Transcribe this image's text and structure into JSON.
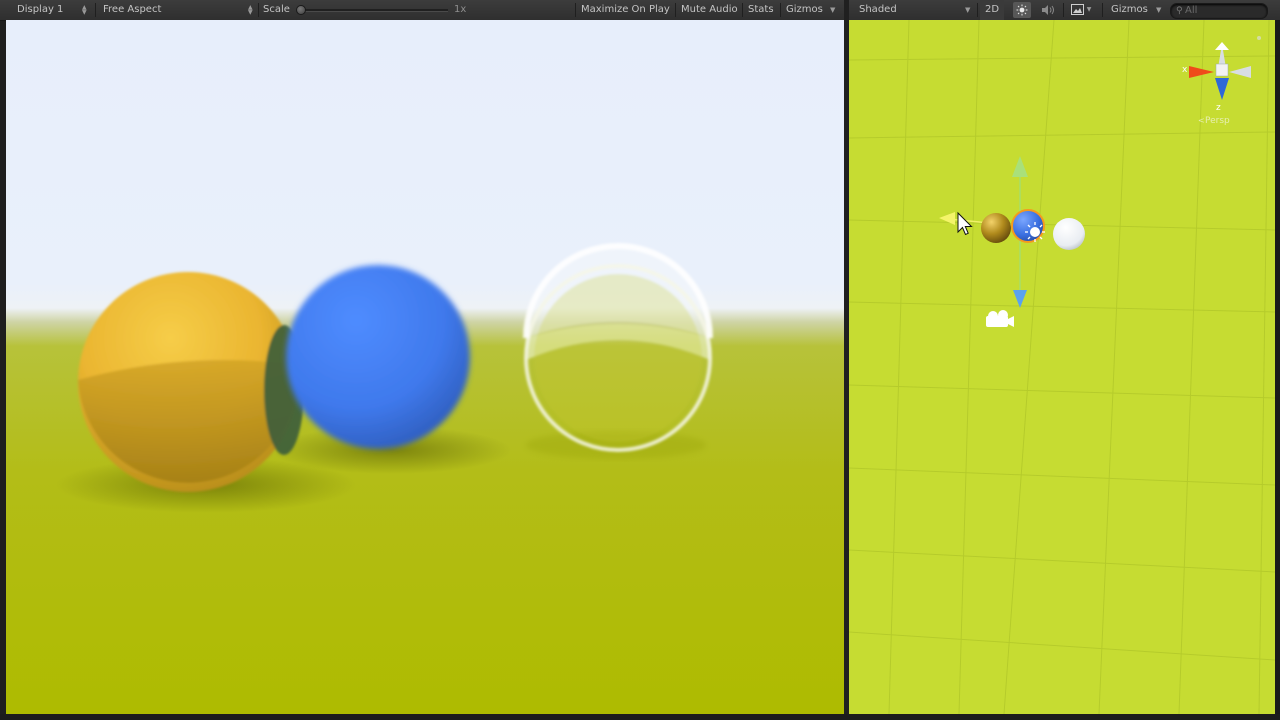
{
  "game_toolbar": {
    "display_select": "Display 1",
    "aspect_select": "Free Aspect",
    "scale_label": "Scale",
    "scale_value": "1x",
    "scale_fraction": 0,
    "maximize_on_play": "Maximize On Play",
    "mute_audio": "Mute Audio",
    "stats": "Stats",
    "gizmos": "Gizmos"
  },
  "scene_toolbar": {
    "draw_mode_select": "Shaded",
    "mode_2d": "2D",
    "lighting_icon": "sun-icon",
    "audio_icon": "speaker-icon",
    "effects_icon": "image-icon",
    "gizmos": "Gizmos",
    "search_placeholder": "All",
    "search_icon": "magnifier-icon"
  },
  "scene_view": {
    "orientation_gizmo": {
      "x_label": "x",
      "z_label": "z",
      "projection_label": "Persp"
    },
    "objects": [
      "gold-sphere",
      "blue-sphere",
      "white-sphere",
      "directional-light",
      "camera"
    ],
    "cursor_icon": "arrow-cursor-icon"
  },
  "game_view": {
    "objects": [
      "yellow-sphere",
      "blue-sphere",
      "glass-sphere",
      "ground-plane",
      "sky"
    ]
  },
  "colors": {
    "toolbar_bg": "#3c3c3c",
    "scene_ground": "#c6dc32",
    "game_ground": "#b3bd18",
    "sky": "#e7eefb",
    "yellow_sphere": "#f1c431",
    "blue_sphere": "#3f7cf0"
  }
}
